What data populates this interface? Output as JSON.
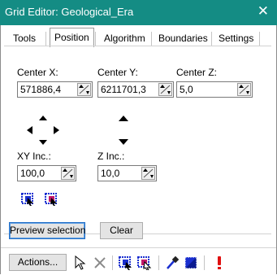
{
  "window": {
    "title": "Grid Editor: Geological_Era"
  },
  "tabs": [
    {
      "label": "Tools"
    },
    {
      "label": "Position"
    },
    {
      "label": "Algorithm"
    },
    {
      "label": "Boundaries"
    },
    {
      "label": "Settings"
    }
  ],
  "position": {
    "center_x_label": "Center X:",
    "center_x_value": "571886,4",
    "center_y_label": "Center Y:",
    "center_y_value": "6211701,3",
    "center_z_label": "Center Z:",
    "center_z_value": "5,0",
    "xy_inc_label": "XY Inc.:",
    "xy_inc_value": "100,0",
    "z_inc_label": "Z Inc.:",
    "z_inc_value": "10,0"
  },
  "buttons": {
    "preview_selection": "Preview selection",
    "clear": "Clear",
    "actions": "Actions..."
  },
  "colors": {
    "titlebar": "#148c84",
    "accent_blue": "#1a2fd0",
    "accent_red": "#e01010"
  }
}
